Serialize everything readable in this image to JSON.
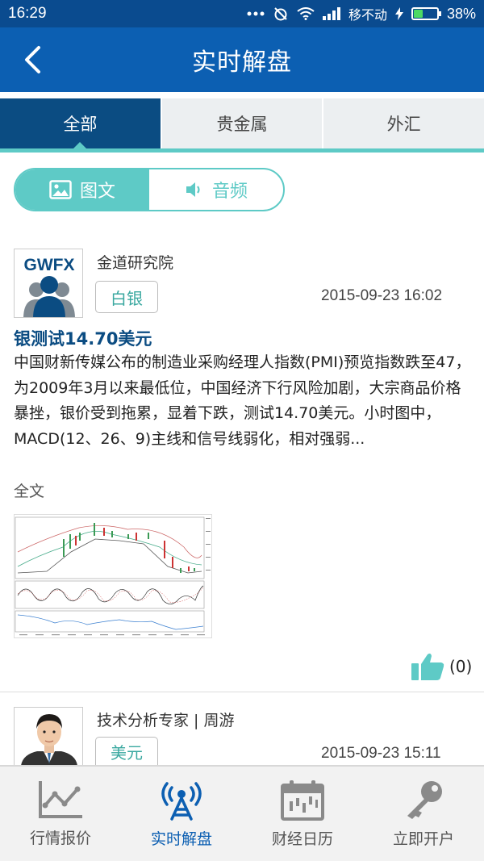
{
  "status_bar": {
    "time": "16:29",
    "carrier": "移不动",
    "battery_text": "38%",
    "battery_level": 0.38
  },
  "header": {
    "title": "实时解盘",
    "back_icon": "chevron-left-icon"
  },
  "tabs": [
    {
      "label": "全部",
      "active": true
    },
    {
      "label": "贵金属",
      "active": false
    },
    {
      "label": "外汇",
      "active": false
    }
  ],
  "segmented": {
    "items": [
      {
        "label": "图文",
        "icon": "image-icon",
        "active": true
      },
      {
        "label": "音频",
        "icon": "speaker-icon",
        "active": false
      }
    ]
  },
  "articles": [
    {
      "avatar_text": "GWFX",
      "author": "金道研究院",
      "tag": "白银",
      "datetime": "2015-09-23 16:02",
      "headline": "银测试14.70美元",
      "body": "中国财新传媒公布的制造业采购经理人指数(PMI)预览指数跌至47，为2009年3月以来最低位，中国经济下行风险加剧，大宗商品价格暴挫，银价受到拖累，显着下跌，测试14.70美元。小时图中，MACD(12、26、9)主线和信号线弱化，相对强弱...",
      "full_text_link": "全文",
      "likes": "(0)"
    },
    {
      "author": "技术分析专家 | 周游",
      "tag": "美元",
      "datetime": "2015-09-23 15:11"
    }
  ],
  "bottom_nav": [
    {
      "label": "行情报价",
      "icon": "line-chart-icon",
      "active": false
    },
    {
      "label": "实时解盘",
      "icon": "broadcast-tower-icon",
      "active": true
    },
    {
      "label": "财经日历",
      "icon": "calendar-icon",
      "active": false
    },
    {
      "label": "立即开户",
      "icon": "key-icon",
      "active": false
    }
  ],
  "colors": {
    "primary": "#0c5fb2",
    "dark_tab": "#0b4c82",
    "accent": "#5ecac6"
  }
}
